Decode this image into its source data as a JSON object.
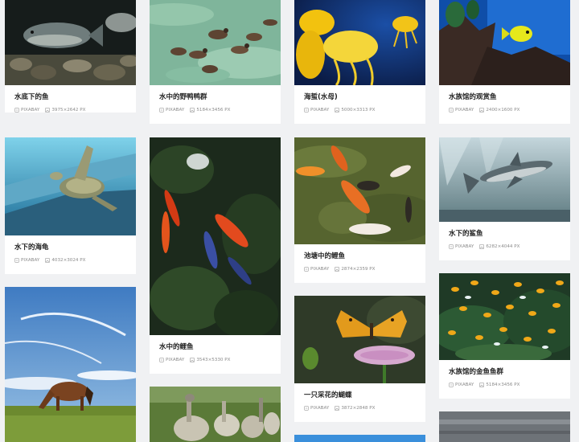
{
  "gallery": {
    "cards": [
      {
        "title": "水底下的鱼",
        "source": "PIXABAY",
        "dimensions": "3975×2642 PX",
        "thumb": "fish-underwater-photo"
      },
      {
        "title": "水下的海龟",
        "source": "PIXABAY",
        "dimensions": "4032×3024 PX",
        "thumb": "sea-turtle-photo"
      },
      {
        "title": "",
        "source": "",
        "dimensions": "",
        "thumb": "horse-grazing-photo"
      },
      {
        "title": "水中的野鸭鸭群",
        "source": "PIXABAY",
        "dimensions": "5184×3456 PX",
        "thumb": "ducks-swimming-photo"
      },
      {
        "title": "水中的鲤鱼",
        "source": "PIXABAY",
        "dimensions": "3543×5330 PX",
        "thumb": "koi-dark-pond-photo"
      },
      {
        "title": "",
        "source": "",
        "dimensions": "",
        "thumb": "geese-photo"
      },
      {
        "title": "海蜇(水母)",
        "source": "PIXABAY",
        "dimensions": "5000×3313 PX",
        "thumb": "jellyfish-photo"
      },
      {
        "title": "池塘中的鲤鱼",
        "source": "PIXABAY",
        "dimensions": "2874×2359 PX",
        "thumb": "koi-pond-photo"
      },
      {
        "title": "一只采花的蝴蝶",
        "source": "PIXABAY",
        "dimensions": "3872×2848 PX",
        "thumb": "butterfly-flower-photo"
      },
      {
        "title": "",
        "source": "",
        "dimensions": "",
        "thumb": "blue-sky-photo"
      },
      {
        "title": "水族馆的观赏鱼",
        "source": "PIXABAY",
        "dimensions": "2400×1600 PX",
        "thumb": "aquarium-fish-photo"
      },
      {
        "title": "水下的鲨鱼",
        "source": "PIXABAY",
        "dimensions": "6282×4044 PX",
        "thumb": "shark-photo"
      },
      {
        "title": "水族馆的金鱼鱼群",
        "source": "PIXABAY",
        "dimensions": "5184×3456 PX",
        "thumb": "goldfish-school-photo"
      },
      {
        "title": "",
        "source": "",
        "dimensions": "",
        "thumb": "gray-water-photo"
      }
    ]
  }
}
